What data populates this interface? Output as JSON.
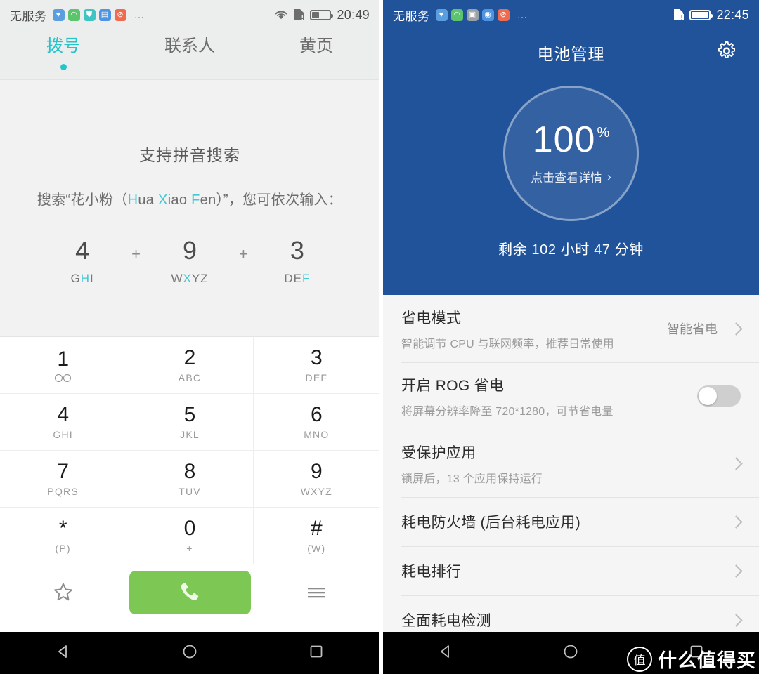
{
  "dialer": {
    "statusbar": {
      "carrier": "无服务",
      "app_icons": [
        {
          "name": "heartrate-icon",
          "color": "#5a9ee0",
          "glyph": "♥"
        },
        {
          "name": "green-app-icon",
          "color": "#5bc46c",
          "glyph": "◠"
        },
        {
          "name": "shield-icon",
          "color": "#3fc4c4",
          "glyph": "⛊"
        },
        {
          "name": "document-icon",
          "color": "#4f93e3",
          "glyph": "▤"
        },
        {
          "name": "mute-icon",
          "color": "#ef6a4e",
          "glyph": "⊘"
        }
      ],
      "overflow": "…",
      "wifi_icon": "wifi-icon",
      "sim_icon": "sim-alert-icon",
      "battery_level_pct": 35,
      "time": "20:49"
    },
    "tabs": [
      {
        "label": "拨号",
        "active": true
      },
      {
        "label": "联系人",
        "active": false
      },
      {
        "label": "黄页",
        "active": false
      }
    ],
    "hint": {
      "title": "支持拼音搜索",
      "subtitle_prefix": "搜索“花小粉（",
      "subtitle_pinyin_1": "H",
      "subtitle_pinyin_1b": "ua ",
      "subtitle_pinyin_2": "X",
      "subtitle_pinyin_2b": "iao ",
      "subtitle_pinyin_3": "F",
      "subtitle_pinyin_3b": "en",
      "subtitle_suffix": "）”，您可依次输入：",
      "codes": [
        {
          "num": "4",
          "letters_before": "G",
          "letters_hl": "H",
          "letters_after": "I"
        },
        {
          "num": "9",
          "letters_before": "W",
          "letters_hl": "X",
          "letters_after": "YZ"
        },
        {
          "num": "3",
          "letters_before": "DE",
          "letters_hl": "F",
          "letters_after": ""
        }
      ],
      "plus": "+"
    },
    "keypad": [
      [
        {
          "digit": "1",
          "sub": "",
          "icon": "voicemail-icon"
        },
        {
          "digit": "2",
          "sub": "ABC"
        },
        {
          "digit": "3",
          "sub": "DEF"
        }
      ],
      [
        {
          "digit": "4",
          "sub": "GHI"
        },
        {
          "digit": "5",
          "sub": "JKL"
        },
        {
          "digit": "6",
          "sub": "MNO"
        }
      ],
      [
        {
          "digit": "7",
          "sub": "PQRS"
        },
        {
          "digit": "8",
          "sub": "TUV"
        },
        {
          "digit": "9",
          "sub": "WXYZ"
        }
      ],
      [
        {
          "digit": "*",
          "sub": "(P)"
        },
        {
          "digit": "0",
          "sub": "+"
        },
        {
          "digit": "#",
          "sub": "(W)"
        }
      ]
    ],
    "actions": {
      "favorite_icon": "star-icon",
      "call_icon": "phone-handset-icon",
      "call_button_color": "#7dc855",
      "menu_icon": "hamburger-menu-icon"
    }
  },
  "battery": {
    "statusbar": {
      "carrier": "无服务",
      "app_icons": [
        {
          "name": "heartrate-icon",
          "color": "#5a9ee0",
          "glyph": "♥"
        },
        {
          "name": "green-app-icon",
          "color": "#5bc46c",
          "glyph": "◠"
        },
        {
          "name": "gallery-icon",
          "color": "#9aa0a6",
          "glyph": "▣"
        },
        {
          "name": "record-icon",
          "color": "#4f93e3",
          "glyph": "◉"
        },
        {
          "name": "mute-icon",
          "color": "#ef6a4e",
          "glyph": "⊘"
        }
      ],
      "overflow": "…",
      "sim_icon": "sim-alert-icon",
      "battery_level_pct": 100,
      "time": "22:45"
    },
    "header": {
      "title": "电池管理",
      "settings_icon": "gear-icon",
      "accent_color": "#20539a"
    },
    "hero": {
      "percent_value": "100",
      "percent_unit": "%",
      "detail_link": "点击查看详情",
      "detail_chevron": "›",
      "remaining": "剩余 102 小时 47 分钟"
    },
    "rows": [
      {
        "title": "省电模式",
        "desc": "智能调节 CPU 与联网频率，推荐日常使用",
        "value": "智能省电",
        "control": "chevron"
      },
      {
        "title": "开启 ROG 省电",
        "desc": "将屏幕分辨率降至 720*1280，可节省电量",
        "value": "",
        "control": "toggle",
        "toggle_on": false
      },
      {
        "title": "受保护应用",
        "desc": "锁屏后，13 个应用保持运行",
        "value": "",
        "control": "chevron"
      },
      {
        "title": "耗电防火墙 (后台耗电应用)",
        "desc": "",
        "value": "",
        "control": "chevron"
      },
      {
        "title": "耗电排行",
        "desc": "",
        "value": "",
        "control": "chevron"
      },
      {
        "title": "全面耗电检测",
        "desc": "",
        "value": "",
        "control": "chevron"
      }
    ],
    "watermark": {
      "badge": "值",
      "text": "什么值得买"
    }
  },
  "navbar": {
    "back_icon": "back-triangle-icon",
    "home_icon": "home-circle-icon",
    "recents_icon": "recents-square-icon"
  }
}
